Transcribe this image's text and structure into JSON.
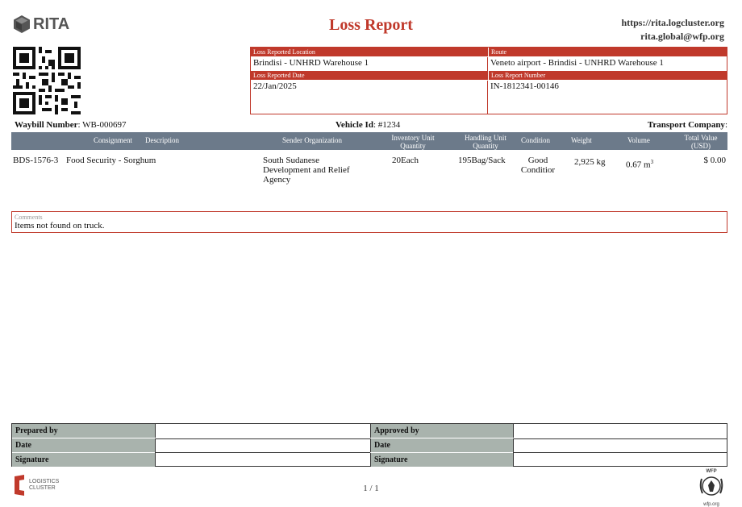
{
  "header": {
    "logo_text": "RITA",
    "title": "Loss Report",
    "website": "https://rita.logcluster.org",
    "email": "rita.global@wfp.org"
  },
  "info": {
    "location_label": "Loss Reported Location",
    "location_value": "Brindisi - UNHRD Warehouse 1",
    "route_label": "Route",
    "route_value": "Veneto airport - Brindisi - UNHRD Warehouse 1",
    "date_label": "Loss Reported Date",
    "date_value": "22/Jan/2025",
    "number_label": "Loss Report Number",
    "number_value": "IN-1812341-00146"
  },
  "meta": {
    "waybill_label": "Waybill Number",
    "waybill_value": "WB-000697",
    "vehicle_label": "Vehicle Id",
    "vehicle_value": "#1234",
    "transport_label": "Transport Company",
    "transport_value": ""
  },
  "table": {
    "headers": {
      "consignment": "Consignment",
      "description": "Description",
      "sender": "Sender Organization",
      "inventory_1": "Inventory Unit",
      "inventory_2": "Quantity",
      "handling_1": "Handling Unit",
      "handling_2": "Quantity",
      "condition": "Condition",
      "weight": "Weight",
      "volume": "Volume",
      "total_1": "Total Value",
      "total_2": "(USD)"
    },
    "rows": [
      {
        "consignment": "BDS-1576-3",
        "description": "Food Security - Sorghum",
        "sender_1": "South Sudanese",
        "sender_2": "Development and Relief",
        "sender_3": "Agency",
        "inventory": "20Each",
        "handling": "195Bag/Sack",
        "condition_1": "Good",
        "condition_2": "Conditior",
        "weight": "2,925 kg",
        "volume": "0.67 m",
        "volume_unit_sup": "3",
        "total": "$ 0.00"
      }
    ]
  },
  "comments": {
    "label": "Comments",
    "value": "Items not found on truck."
  },
  "signatures": {
    "prepared_by": "Prepared by",
    "approved_by": "Approved by",
    "date": "Date",
    "signature": "Signature"
  },
  "footer": {
    "page": "1 / 1",
    "lc_line1": "LOGISTICS",
    "lc_line2": "CLUSTER",
    "wfp_top": "WFP",
    "wfp_bottom": "wfp.org"
  },
  "colors": {
    "accent": "#c0392b",
    "table_header": "#6c7a8a",
    "signature_label": "#a9b3ad"
  }
}
